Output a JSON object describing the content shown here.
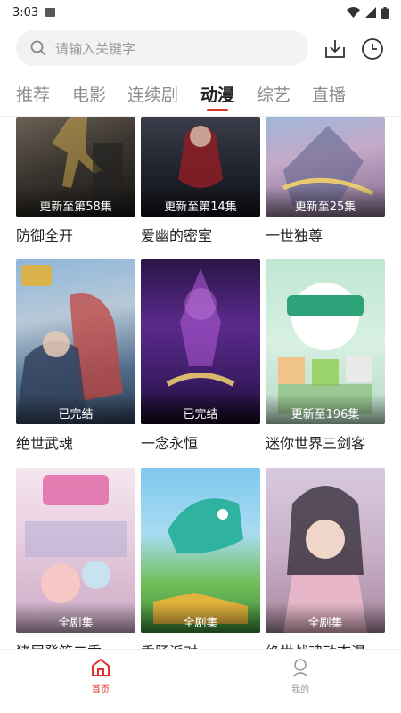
{
  "status_bar": {
    "time": "3:03"
  },
  "search": {
    "placeholder": "请输入关键字"
  },
  "tabs": [
    {
      "label": "推荐"
    },
    {
      "label": "电影"
    },
    {
      "label": "连续剧"
    },
    {
      "label": "动漫",
      "active": true
    },
    {
      "label": "综艺"
    },
    {
      "label": "直播"
    }
  ],
  "grid": {
    "rows": [
      [
        {
          "title": "防御全开",
          "badge": "更新至第58集"
        },
        {
          "title": "爱幽的密室",
          "badge": "更新至第14集"
        },
        {
          "title": "一世独尊",
          "badge": "更新至25集"
        }
      ],
      [
        {
          "title": "绝世武魂",
          "badge": "已完结"
        },
        {
          "title": "一念永恒",
          "badge": "已完结"
        },
        {
          "title": "迷你世界三剑客",
          "badge": "更新至196集"
        }
      ],
      [
        {
          "title": "猪屁登第二季",
          "badge": "全剧集"
        },
        {
          "title": "香肠派对",
          "badge": "全剧集"
        },
        {
          "title": "绝世战魂动态漫",
          "badge": "全剧集"
        }
      ]
    ]
  },
  "bottom_nav": [
    {
      "label": "首页",
      "active": true
    },
    {
      "label": "我的",
      "active": false
    }
  ],
  "colors": {
    "accent": "#e0322d",
    "inactive": "#9a9a9a",
    "search_bg": "#f2f2f2"
  }
}
